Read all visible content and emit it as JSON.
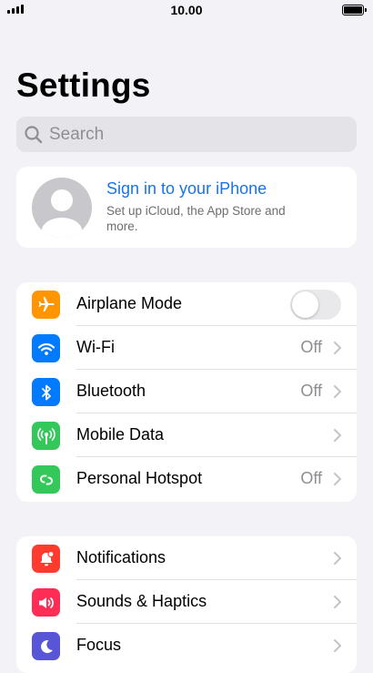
{
  "status_bar": {
    "time": "10.00",
    "signal_icon": "cellular-signal-icon",
    "battery_icon": "battery-icon"
  },
  "page": {
    "title": "Settings"
  },
  "search": {
    "placeholder": "Search",
    "icon": "search-icon"
  },
  "account": {
    "title": "Sign in to your iPhone",
    "subtitle": "Set up iCloud, the App Store and more.",
    "icon": "person-icon"
  },
  "groups": [
    {
      "items": [
        {
          "label": "Airplane Mode",
          "icon": "airplane-icon",
          "color": "#ff9500",
          "control": "toggle",
          "on": false
        },
        {
          "label": "Wi-Fi",
          "icon": "wifi-icon",
          "color": "#007aff",
          "value": "Off"
        },
        {
          "label": "Bluetooth",
          "icon": "bluetooth-icon",
          "color": "#007aff",
          "value": "Off"
        },
        {
          "label": "Mobile Data",
          "icon": "antenna-icon",
          "color": "#34c759",
          "value": ""
        },
        {
          "label": "Personal Hotspot",
          "icon": "hotspot-icon",
          "color": "#34c759",
          "value": "Off"
        }
      ]
    },
    {
      "items": [
        {
          "label": "Notifications",
          "icon": "notification-bell-icon",
          "color": "#ff3b30",
          "value": ""
        },
        {
          "label": "Sounds & Haptics",
          "icon": "speaker-icon",
          "color": "#ff2d55",
          "value": ""
        },
        {
          "label": "Focus",
          "icon": "moon-icon",
          "color": "#5856d6",
          "value": ""
        }
      ]
    }
  ]
}
